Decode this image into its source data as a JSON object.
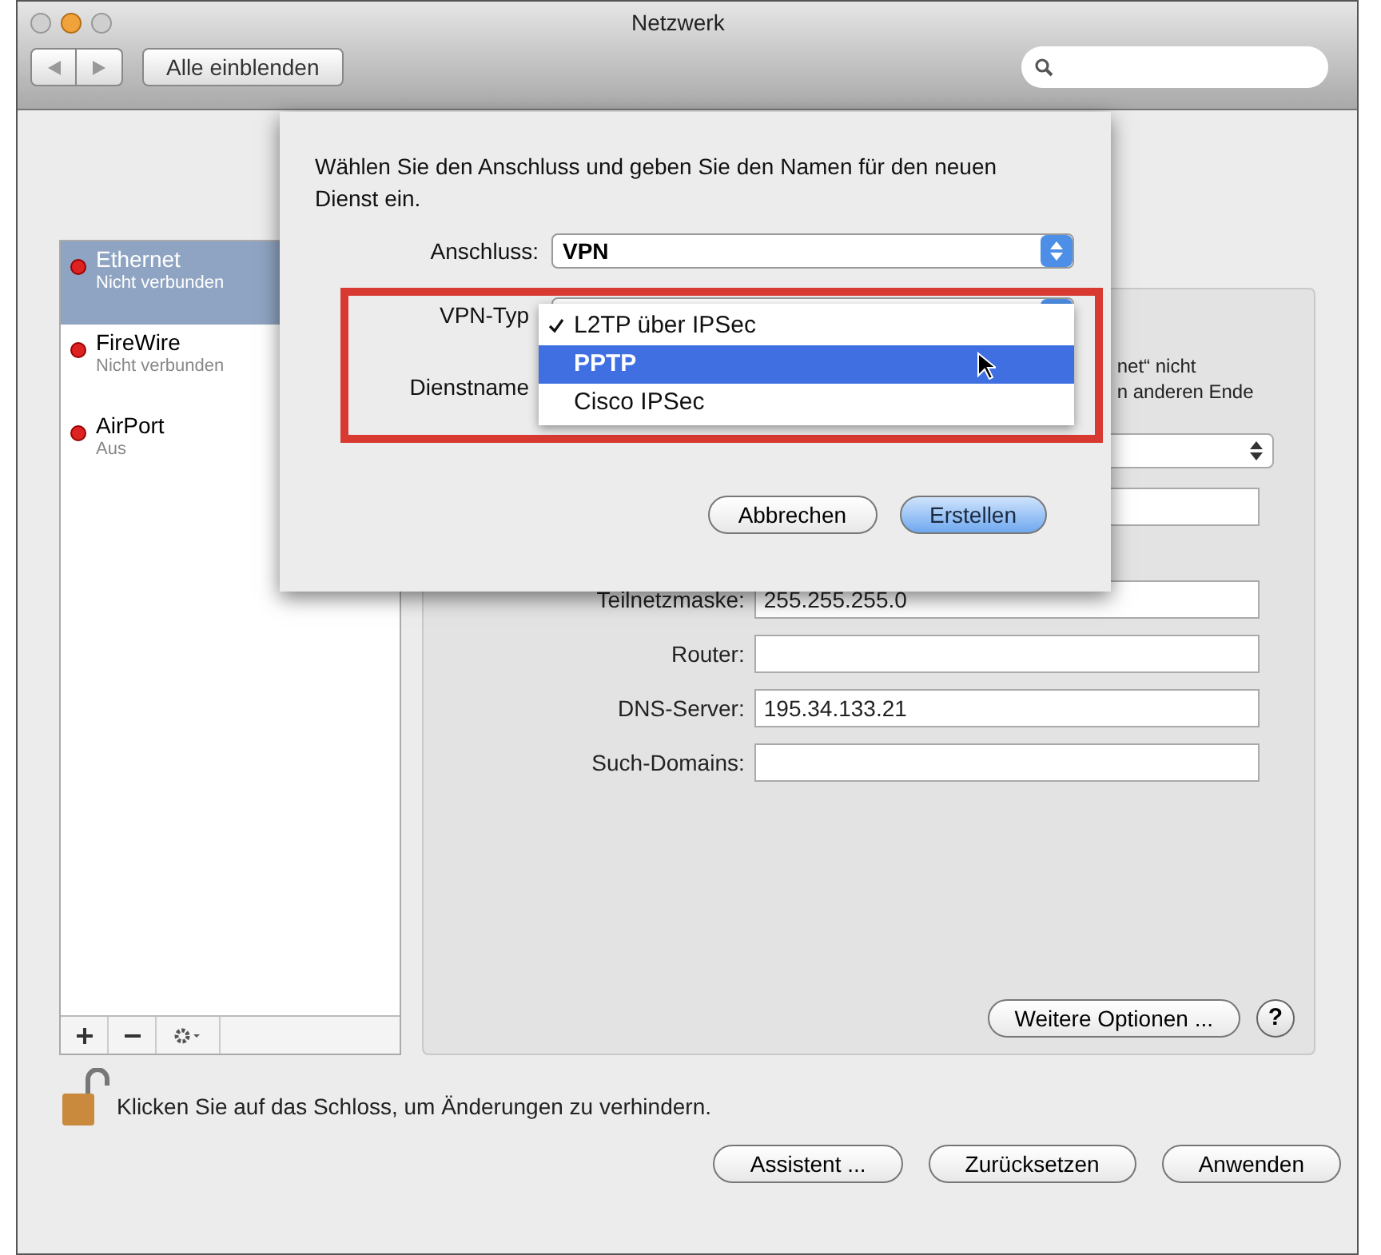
{
  "window": {
    "title": "Netzwerk",
    "show_all": "Alle einblenden"
  },
  "sidebar": {
    "services": [
      {
        "name": "Ethernet",
        "status": "Nicht verbunden",
        "selected": true
      },
      {
        "name": "FireWire",
        "status": "Nicht verbunden",
        "selected": false
      },
      {
        "name": "AirPort",
        "status": "Aus",
        "selected": false
      }
    ]
  },
  "panel": {
    "status_lines": [
      "net“ nicht",
      "n anderen Ende"
    ],
    "fields": [
      {
        "label": "Teilnetzmaske:",
        "value": "255.255.255.0"
      },
      {
        "label": "Router:"
      },
      {
        "label": "DNS-Server:",
        "value": "195.34.133.21"
      },
      {
        "label": "Such-Domains:"
      }
    ],
    "more_options": "Weitere Optionen ...",
    "help": "?"
  },
  "lock_text": "Klicken Sie auf das Schloss, um Änderungen zu verhindern.",
  "bottom_buttons": [
    "Assistent ...",
    "Zurücksetzen",
    "Anwenden"
  ],
  "sheet": {
    "prompt": "Wählen Sie den Anschluss und geben Sie den Namen für den neuen Dienst ein.",
    "connection": {
      "label": "Anschluss:",
      "value": "VPN"
    },
    "vpn_type": {
      "label": "VPN-Typ",
      "options": [
        {
          "label": "L2TP über IPSec",
          "checked": true,
          "selected": false
        },
        {
          "label": "PPTP",
          "checked": false,
          "selected": true
        },
        {
          "label": "Cisco IPSec",
          "checked": false,
          "selected": false
        }
      ]
    },
    "service_name": {
      "label": "Dienstname"
    },
    "buttons": [
      {
        "label": "Abbrechen",
        "default": false
      },
      {
        "label": "Erstellen",
        "default": true
      }
    ]
  }
}
